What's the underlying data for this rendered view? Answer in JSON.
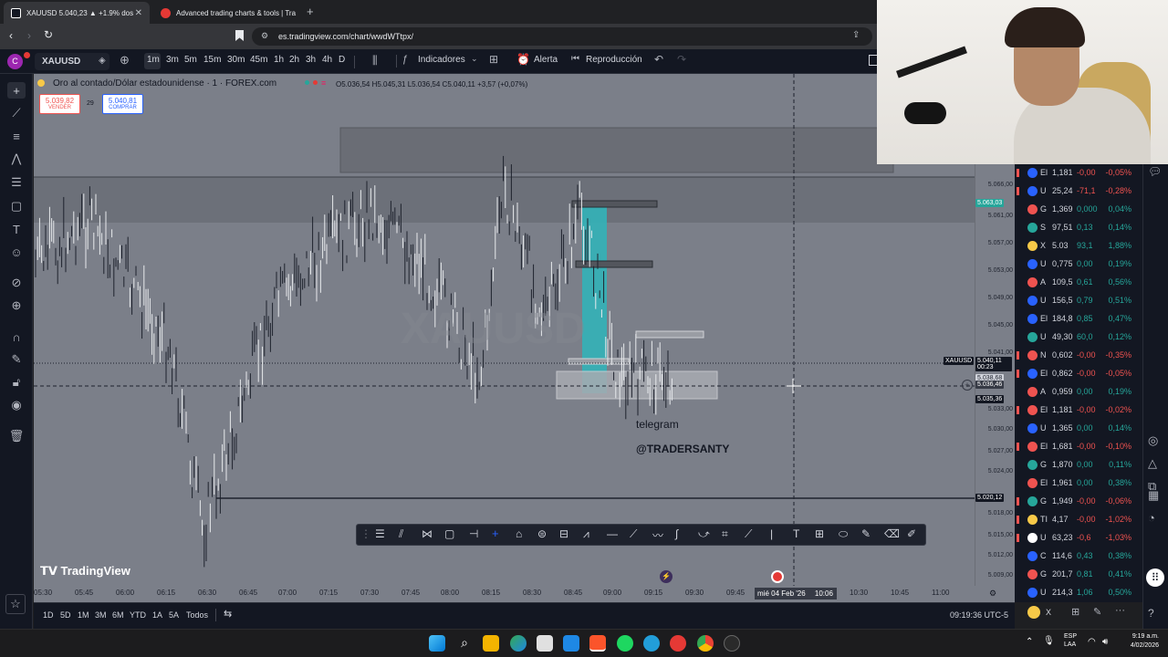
{
  "browser": {
    "tabs": [
      {
        "label": "XAUUSD 5.040,23 ▲ +1.9% dos",
        "active": true
      },
      {
        "label": "Advanced trading charts & tools | Tra",
        "active": false
      }
    ],
    "new_tab": "+",
    "url": "es.tradingview.com/chart/wwdWTtpx/"
  },
  "toolbar": {
    "symbol": "XAUUSD",
    "timeframes": [
      "1m",
      "3m",
      "5m",
      "15m",
      "30m",
      "45m",
      "1h",
      "2h",
      "3h",
      "4h",
      "D"
    ],
    "active_timeframe": "1m",
    "indicators": "Indicadores",
    "alert": "Alerta",
    "replay": "Reproducción"
  },
  "legend": {
    "title": "Oro al contado/Dólar estadounidense · 1 · FOREX.com",
    "ohlc": "O5.036,54 H5.045,31 L5.036,54 C5.040,11 +3,57 (+0,07%)",
    "sell_price": "5.039,82",
    "sell_label": "VENDER",
    "spread": "29",
    "buy_price": "5.040,81",
    "buy_label": "COMPRAR"
  },
  "chart": {
    "watermark": "XAUUSD",
    "annotation_line1": "telegram",
    "annotation_line2": "@TRADERSANTY",
    "logo": "TradingView",
    "crosshair_date": "mié 04 Feb '26",
    "crosshair_time": "10:06"
  },
  "price_axis": {
    "ticks": [
      "5.066,00",
      "5.061,00",
      "5.057,00",
      "5.053,00",
      "5.049,00",
      "5.045,00",
      "5.041,00",
      "5.033,00",
      "5.030,00",
      "5.027,00",
      "5.024,00",
      "5.018,00",
      "5.015,00",
      "5.012,00",
      "5.009,00"
    ],
    "label_top": "5.063,03",
    "symbol_tag": "XAUUSD",
    "last_price": "5.040,11",
    "countdown": "00:23",
    "hidden_tag": "5.038,68",
    "crosshair_price": "5.036,46",
    "line_price": "5.035,36",
    "low_line_price": "5.020,12"
  },
  "time_axis": {
    "ticks": [
      "05:30",
      "05:45",
      "06:00",
      "06:15",
      "06:30",
      "06:45",
      "07:00",
      "07:15",
      "07:30",
      "07:45",
      "08:00",
      "08:15",
      "08:30",
      "08:45",
      "09:00",
      "09:15",
      "09:30",
      "09:45",
      "10:30",
      "10:45",
      "11:00"
    ]
  },
  "bottom": {
    "ranges": [
      "1D",
      "5D",
      "1M",
      "3M",
      "6M",
      "YTD",
      "1A",
      "5A",
      "Todos"
    ],
    "clock": "09:19:36 UTC-5"
  },
  "watchlist": [
    {
      "sym": "El",
      "price": "1,181",
      "chg": "-0,00",
      "pct": "-0,05%",
      "up": false
    },
    {
      "sym": "U",
      "price": "25,24",
      "chg": "-71,1",
      "pct": "-0,28%",
      "up": false
    },
    {
      "sym": "G",
      "price": "1,369",
      "chg": "0,000",
      "pct": "0,04%",
      "up": true
    },
    {
      "sym": "S",
      "price": "97,51",
      "chg": "0,13",
      "pct": "0,14%",
      "up": true
    },
    {
      "sym": "X",
      "price": "5.03",
      "chg": "93,1",
      "pct": "1,88%",
      "up": true
    },
    {
      "sym": "U",
      "price": "0,775",
      "chg": "0,00",
      "pct": "0,19%",
      "up": true
    },
    {
      "sym": "A",
      "price": "109,5",
      "chg": "0,61",
      "pct": "0,56%",
      "up": true
    },
    {
      "sym": "U",
      "price": "156,5",
      "chg": "0,79",
      "pct": "0,51%",
      "up": true
    },
    {
      "sym": "El",
      "price": "184,8",
      "chg": "0,85",
      "pct": "0,47%",
      "up": true
    },
    {
      "sym": "U",
      "price": "49,30",
      "chg": "60,0",
      "pct": "0,12%",
      "up": true
    },
    {
      "sym": "N",
      "price": "0,602",
      "chg": "-0,00",
      "pct": "-0,35%",
      "up": false
    },
    {
      "sym": "El",
      "price": "0,862",
      "chg": "-0,00",
      "pct": "-0,05%",
      "up": false
    },
    {
      "sym": "A",
      "price": "0,959",
      "chg": "0,00",
      "pct": "0,19%",
      "up": true
    },
    {
      "sym": "El",
      "price": "1,181",
      "chg": "-0,00",
      "pct": "-0,02%",
      "up": false
    },
    {
      "sym": "U",
      "price": "1,365",
      "chg": "0,00",
      "pct": "0,14%",
      "up": true
    },
    {
      "sym": "El",
      "price": "1,681",
      "chg": "-0,00",
      "pct": "-0,10%",
      "up": false
    },
    {
      "sym": "G",
      "price": "1,870",
      "chg": "0,00",
      "pct": "0,11%",
      "up": true
    },
    {
      "sym": "El",
      "price": "1,961",
      "chg": "0,00",
      "pct": "0,38%",
      "up": true
    },
    {
      "sym": "G",
      "price": "1,949",
      "chg": "-0,00",
      "pct": "-0,06%",
      "up": false
    },
    {
      "sym": "TI",
      "price": "4,17",
      "chg": "-0,00",
      "pct": "-1,02%",
      "up": false
    },
    {
      "sym": "U",
      "price": "63,23",
      "chg": "-0,6",
      "pct": "-1,03%",
      "up": false
    },
    {
      "sym": "C",
      "price": "114,6",
      "chg": "0,43",
      "pct": "0,38%",
      "up": true
    },
    {
      "sym": "G",
      "price": "201,7",
      "chg": "0,81",
      "pct": "0,41%",
      "up": true
    },
    {
      "sym": "U",
      "price": "214,3",
      "chg": "1,06",
      "pct": "0,50%",
      "up": true
    }
  ],
  "watch_footer": "X",
  "taskbar": {
    "lang": "ESP",
    "lang2": "LAA",
    "time": "9:19 a.m.",
    "date": "4/02/2026"
  },
  "colors": {
    "up": "#26a69a",
    "down": "#ef5350",
    "chart_bg": "#7b7f89",
    "panel": "#131722",
    "accent": "#2962ff",
    "teal_zone": "#33b3b8"
  }
}
